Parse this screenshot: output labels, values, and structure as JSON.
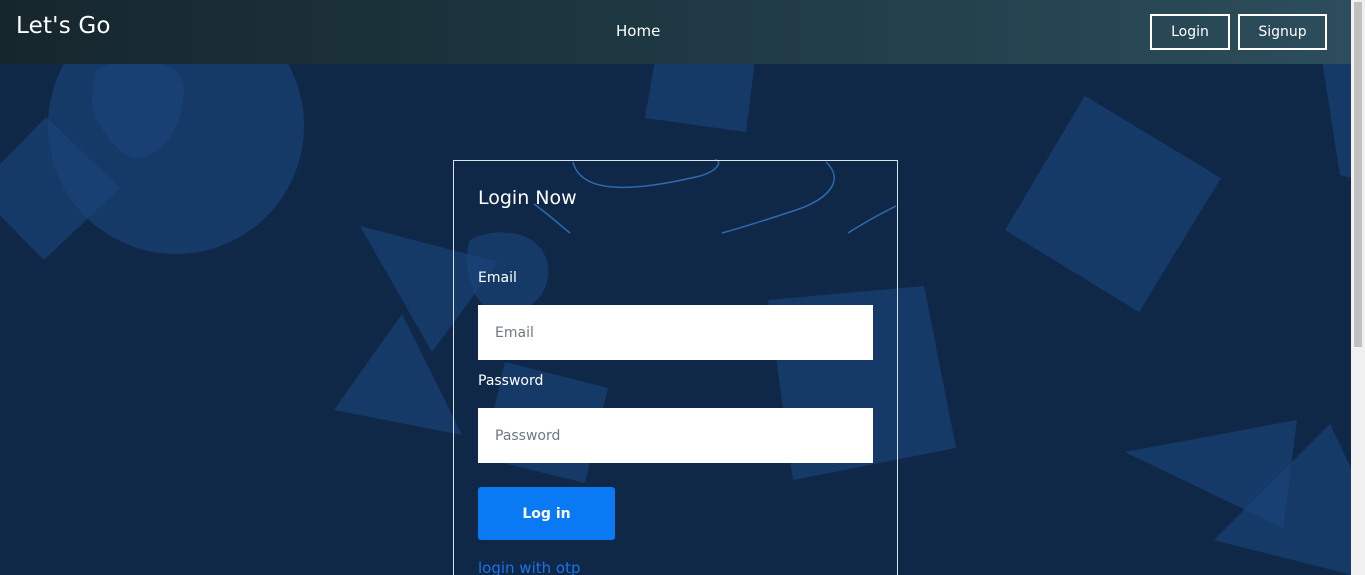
{
  "navbar": {
    "brand": "Let's Go",
    "home_label": "Home",
    "login_label": "Login",
    "signup_label": "Signup"
  },
  "login_form": {
    "title": "Login Now",
    "email_label": "Email",
    "email_placeholder": "Email",
    "email_value": "",
    "password_label": "Password",
    "password_placeholder": "Password",
    "password_value": "",
    "submit_label": "Log in",
    "otp_link": "login with otp"
  },
  "colors": {
    "background": "#0f2848",
    "shape": "#1a4479",
    "button": "#0a7af4",
    "link": "#1a73e8"
  }
}
